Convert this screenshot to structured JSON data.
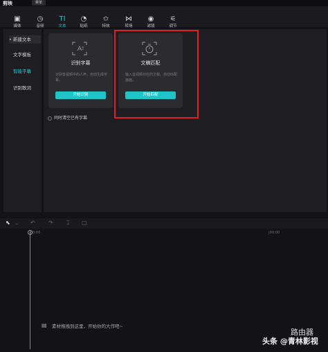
{
  "app": {
    "title": "剪映",
    "menu_label": "菜单"
  },
  "toolbar": {
    "tools": [
      {
        "label": "媒体",
        "icon": "media-icon"
      },
      {
        "label": "音频",
        "icon": "audio-icon"
      },
      {
        "label": "文本",
        "icon": "text-icon"
      },
      {
        "label": "贴纸",
        "icon": "sticker-icon"
      },
      {
        "label": "特效",
        "icon": "effects-icon"
      },
      {
        "label": "转场",
        "icon": "transition-icon"
      },
      {
        "label": "滤镜",
        "icon": "filter-icon"
      },
      {
        "label": "调节",
        "icon": "adjust-icon"
      }
    ],
    "active_index": 2,
    "accent_color": "#22c7c9"
  },
  "sidebar": {
    "items": [
      {
        "label": "• 新建文本"
      },
      {
        "label": "文字模板"
      },
      {
        "label": "智能字幕"
      },
      {
        "label": "识别歌词"
      }
    ],
    "active_index": 2
  },
  "cards": [
    {
      "title": "识别字幕",
      "desc": "识别音视频中的人声，自动生成字幕。",
      "button": "开始识别",
      "icon": "subtitle-recognize-icon"
    },
    {
      "title": "文稿匹配",
      "desc": "输入音视频对应的文稿，自动匹配画面。",
      "button": "开始匹配",
      "icon": "script-match-icon"
    }
  ],
  "checkbox": {
    "label": "同时清空已有字幕"
  },
  "timeline": {
    "ruler": [
      "00:00",
      "|00:00"
    ],
    "drop_hint": "素材拖拽到这里，开始你的大作吧~"
  },
  "watermark": {
    "left": "头条 @青林影视",
    "right": "路由器"
  },
  "colors": {
    "highlight": "#e02020",
    "button": "#1fc4c6"
  }
}
